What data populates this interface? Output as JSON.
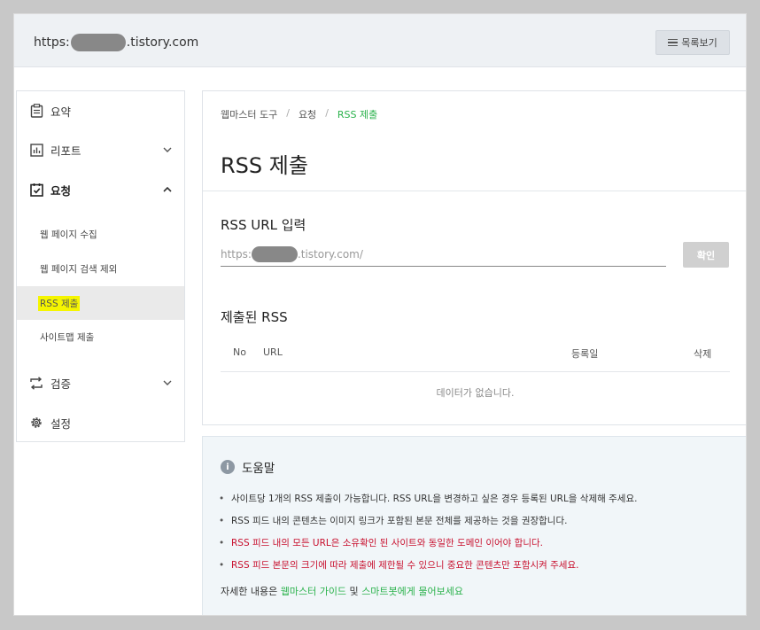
{
  "header": {
    "url_prefix": "https:",
    "url_suffix": ".tistory.com",
    "list_button": "목록보기",
    "list_icon": "list-icon"
  },
  "sidebar": {
    "items": [
      {
        "label": "요약",
        "icon": "clipboard-icon"
      },
      {
        "label": "리포트",
        "icon": "chart-icon",
        "chevron": "down"
      },
      {
        "label": "요청",
        "icon": "checklist-icon",
        "chevron": "up"
      },
      {
        "label": "검증",
        "icon": "repeat-icon",
        "chevron": "down"
      },
      {
        "label": "설정",
        "icon": "gear-icon"
      }
    ],
    "subitems": [
      {
        "label": "웹 페이지 수집"
      },
      {
        "label": "웹 페이지 검색 제외"
      },
      {
        "label": "RSS 제출",
        "active": true
      },
      {
        "label": "사이트맵 제출"
      }
    ]
  },
  "main": {
    "breadcrumb": [
      "웹마스터 도구",
      "요청",
      "RSS 제출"
    ],
    "title": "RSS 제출",
    "rss_url_label": "RSS URL 입력",
    "rss_input_prefix": "https:",
    "rss_input_suffix": ".tistory.com/",
    "confirm_button": "확인",
    "submitted_title": "제출된 RSS",
    "table_headers": [
      "No",
      "URL",
      "등록일",
      "삭제"
    ],
    "empty_message": "데이터가 없습니다."
  },
  "help": {
    "title": "도움말",
    "items": [
      {
        "text": "사이트당 1개의 RSS 제출이 가능합니다. RSS URL을 변경하고 싶은 경우 등록된 URL을 삭제해 주세요.",
        "highlight": false
      },
      {
        "text": "RSS 피드 내의 콘텐츠는 이미지 링크가 포함된 본문 전체를 제공하는 것을 권장합니다.",
        "highlight": false
      },
      {
        "text": "RSS 피드 내의 모든 URL은 소유확인 된 사이트와 동일한 도메인 이어야 합니다.",
        "highlight": true
      },
      {
        "text": "RSS 피드 본문의 크기에 따라 제출에 제한될 수 있으니 중요한 콘텐츠만 포함시켜 주세요.",
        "highlight": true
      }
    ],
    "footer_prefix": "자세한 내용은 ",
    "guide_link": "웹마스터 가이드",
    "footer_mid": " 및 ",
    "bot_link": "스마트봇에게 물어보세요"
  },
  "colors": {
    "accent": "#2bb24c",
    "warning": "#c8102e",
    "highlight": "#f5f500"
  }
}
